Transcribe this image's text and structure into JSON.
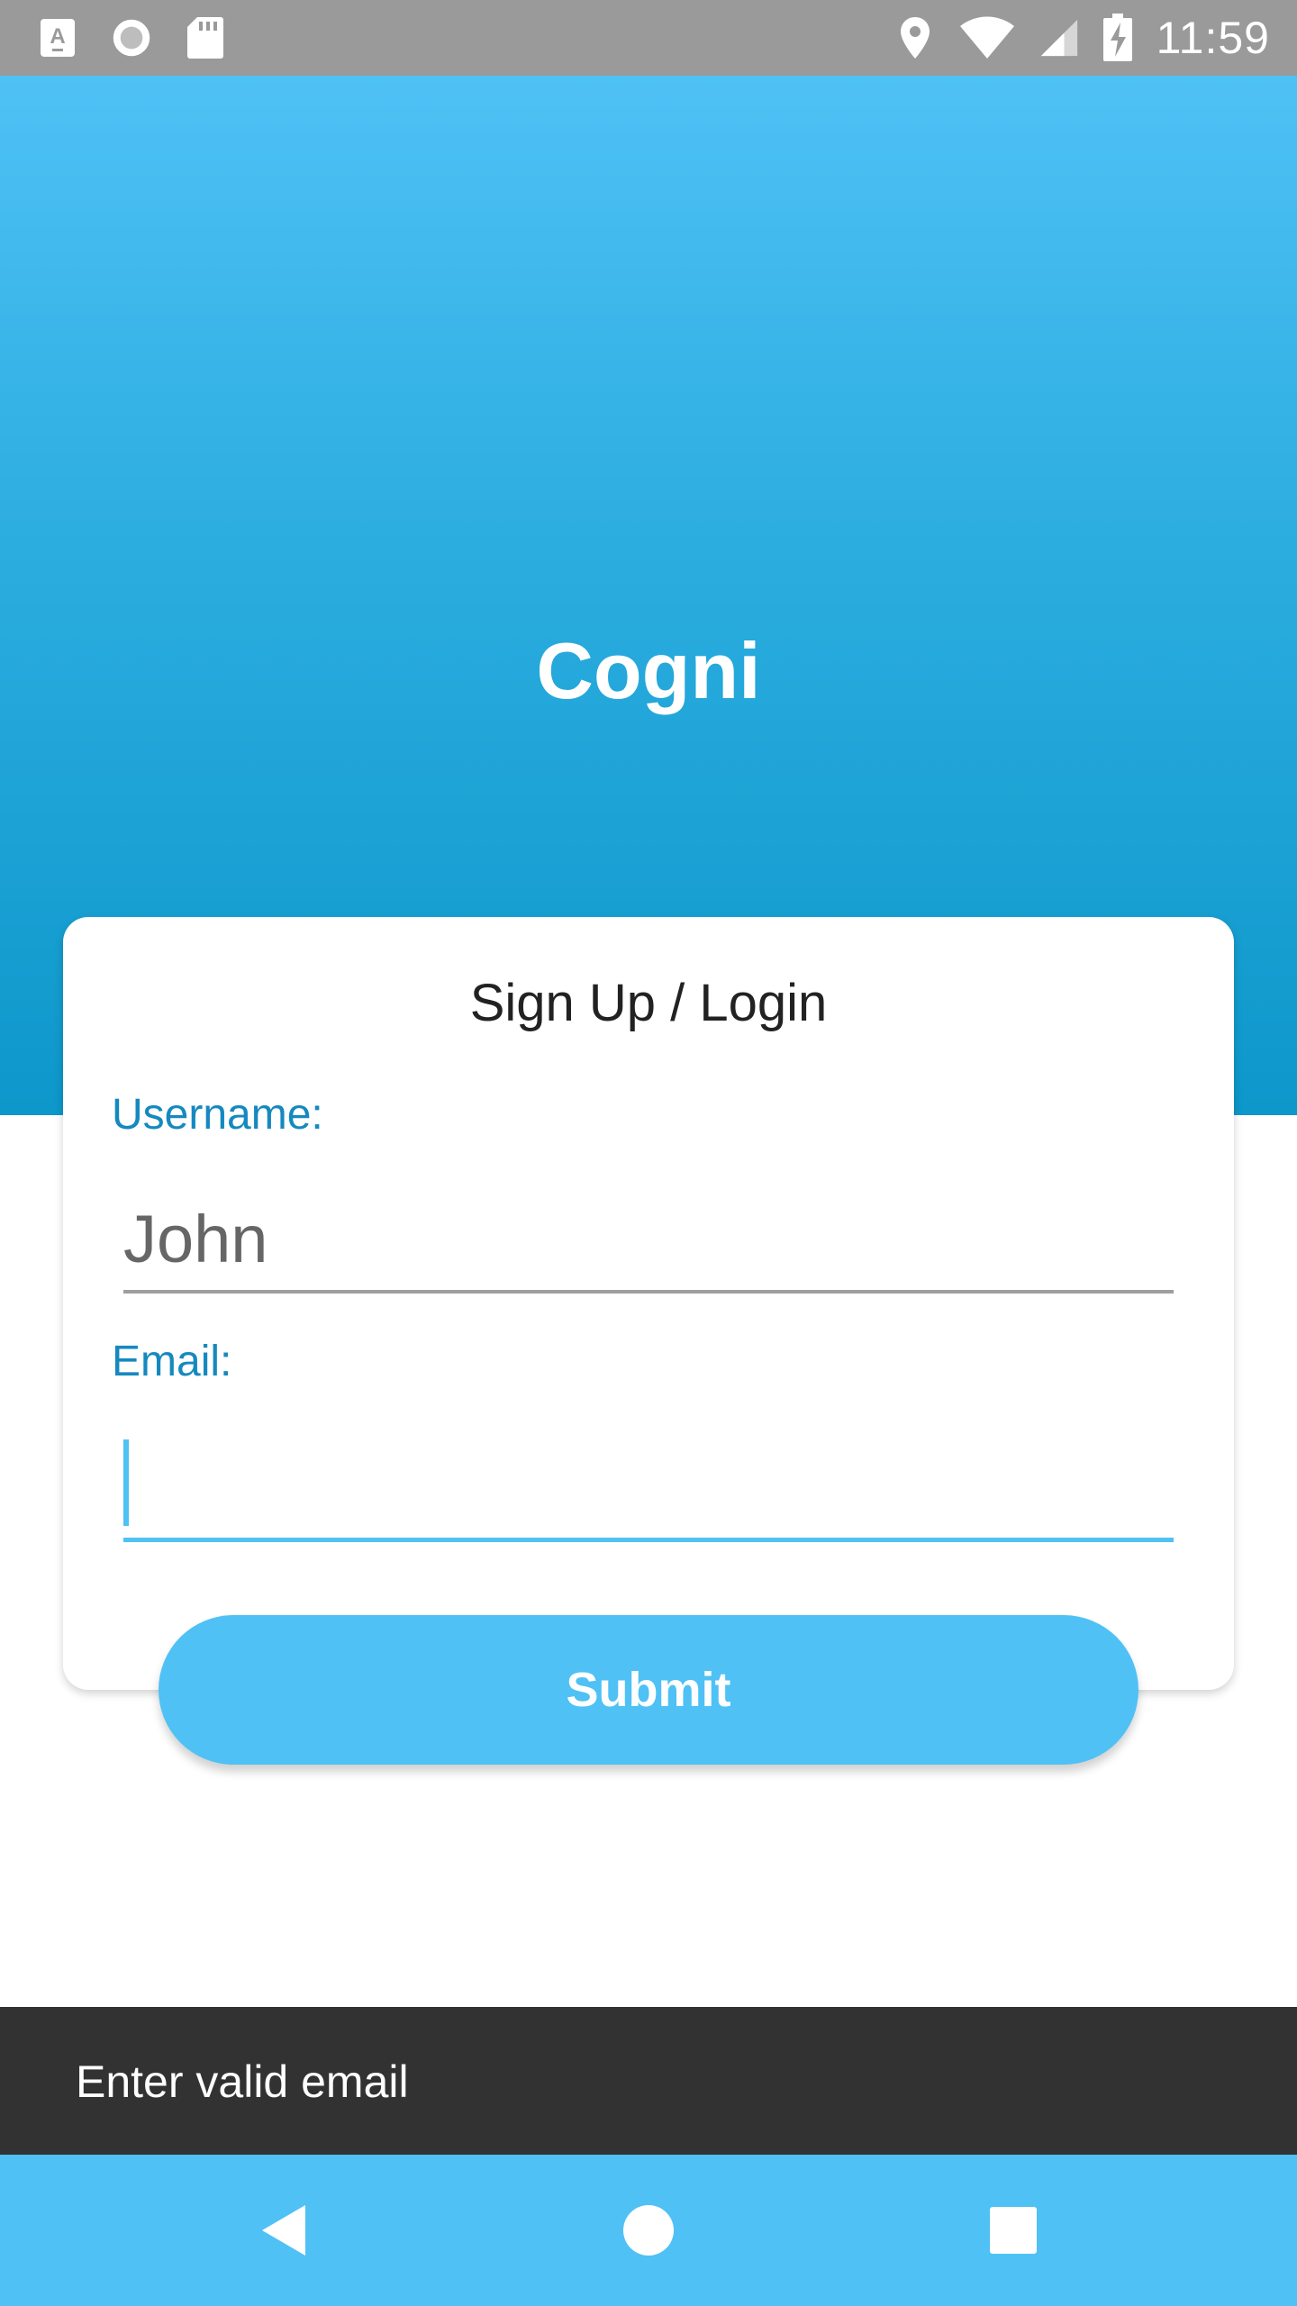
{
  "status_bar": {
    "time": "11:59",
    "left_icons": [
      "keyboard-a-icon",
      "circle-record-icon",
      "sd-card-icon"
    ],
    "right_icons": [
      "location-pin-icon",
      "wifi-icon",
      "cell-signal-icon",
      "battery-charging-icon"
    ]
  },
  "header": {
    "app_title": "Cogni",
    "gradient_top": "#4fc1f5",
    "gradient_bottom": "#0d97ca"
  },
  "card": {
    "title": "Sign Up / Login",
    "username_label": "Username:",
    "username_value": "John",
    "email_label": "Email:",
    "email_value": ""
  },
  "submit_button": {
    "label": "Submit",
    "color": "#4fc1f5"
  },
  "snackbar": {
    "message": "Enter valid email"
  },
  "nav_bar": {
    "buttons": [
      "back-icon",
      "home-icon",
      "recents-icon"
    ],
    "color": "#4fc1f5"
  }
}
